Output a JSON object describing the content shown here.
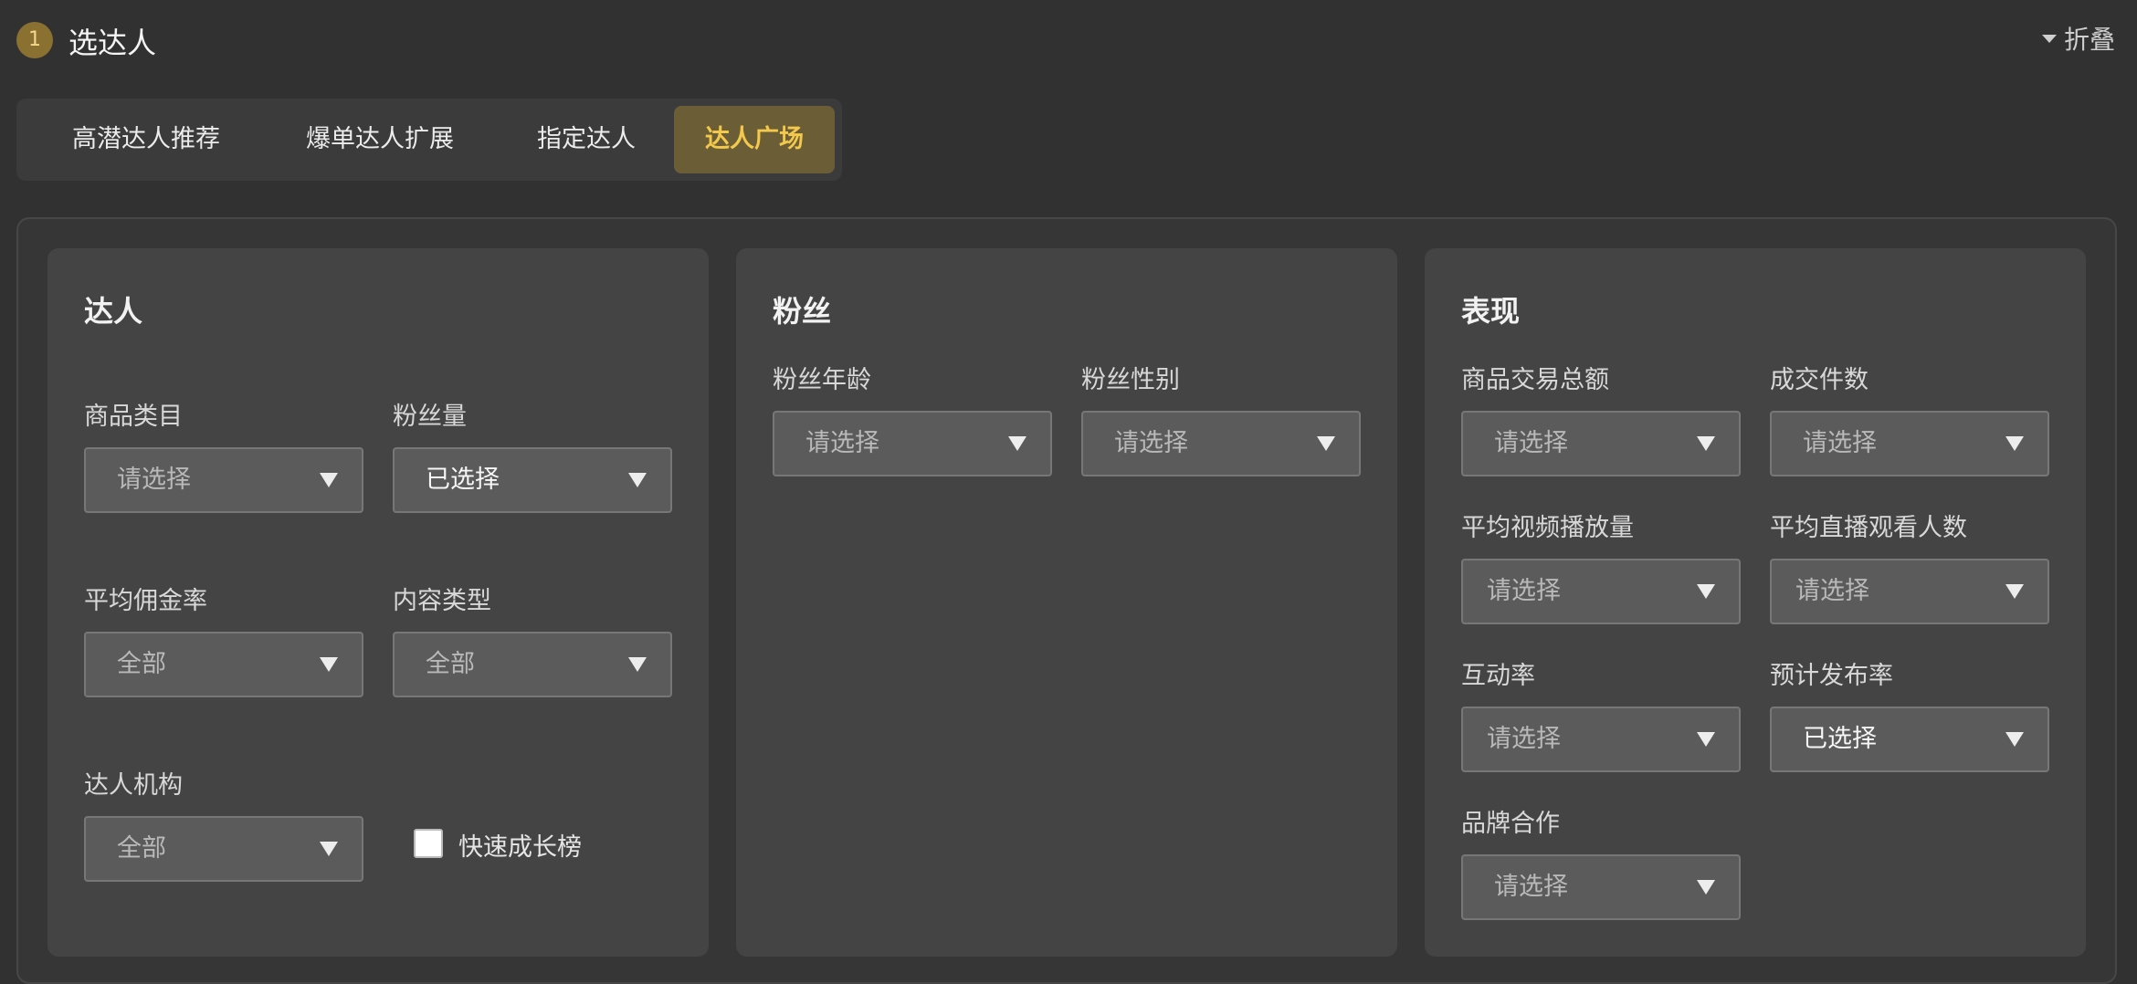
{
  "header": {
    "step_number": "1",
    "title": "选达人",
    "collapse_label": "折叠"
  },
  "tabs": [
    {
      "label": "高潜达人推荐",
      "active": false
    },
    {
      "label": "爆单达人扩展",
      "active": false
    },
    {
      "label": "指定达人",
      "active": false
    },
    {
      "label": "达人广场",
      "active": true
    }
  ],
  "panels": {
    "creator": {
      "title": "达人",
      "fields": [
        {
          "label": "商品类目",
          "value": "请选择",
          "filled": false
        },
        {
          "label": "粉丝量",
          "value": "已选择",
          "filled": true
        },
        {
          "label": "平均佣金率",
          "value": "全部",
          "filled": false
        },
        {
          "label": "内容类型",
          "value": "全部",
          "filled": false
        },
        {
          "label": "达人机构",
          "value": "全部",
          "filled": false
        }
      ],
      "checkbox": {
        "label": "快速成长榜",
        "checked": false
      }
    },
    "fans": {
      "title": "粉丝",
      "fields": [
        {
          "label": "粉丝年龄",
          "value": "请选择",
          "filled": false
        },
        {
          "label": "粉丝性别",
          "value": "请选择",
          "filled": false
        }
      ]
    },
    "performance": {
      "title": "表现",
      "fields": [
        {
          "label": "商品交易总额",
          "value": "请选择",
          "filled": false
        },
        {
          "label": "成交件数",
          "value": "请选择",
          "filled": false
        },
        {
          "label": "平均视频播放量",
          "value": "请选择",
          "filled": false
        },
        {
          "label": "平均直播观看人数",
          "value": "请选择",
          "filled": false
        },
        {
          "label": "互动率",
          "value": "请选择",
          "filled": false
        },
        {
          "label": "预计发布率",
          "value": "已选择",
          "filled": true
        },
        {
          "label": "品牌合作",
          "value": "请选择",
          "filled": false
        }
      ]
    }
  },
  "colors": {
    "accent": "#f2c94c",
    "active_tab_bg": "#6b5d35",
    "page_bg": "#313131",
    "card_bg": "#444444"
  }
}
